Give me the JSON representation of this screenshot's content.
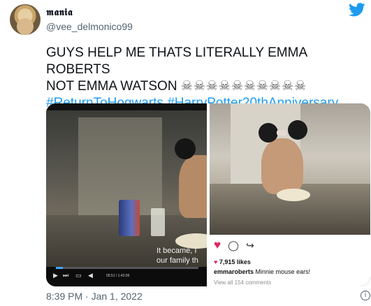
{
  "author": {
    "display_name": "𝖒𝖆𝖓𝖎𝖆",
    "handle": "@vee_delmonico99"
  },
  "tweet": {
    "line1": "GUYS HELP ME THATS LITERALLY EMMA ROBERTS",
    "line2": "NOT EMMA WATSON",
    "skulls": "☠☠☠☠☠☠☠☠☠☠",
    "hashtag1": "#ReturnToHogwarts",
    "hashtag2": "#HarryPotter20thAnniversary"
  },
  "video": {
    "subtitle_line1": "It became, I",
    "subtitle_line2": "our family th",
    "time": "05:51 / 1:42:06",
    "progress": 0.05
  },
  "instagram": {
    "likes": "7,915 likes",
    "caption_user": "emmaroberts",
    "caption_text": "Minnie mouse ears!",
    "view_comments": "View all 154 comments"
  },
  "footer": {
    "timestamp": "8:39 PM · Jan 1, 2022"
  },
  "colors": {
    "accent": "#1d9bf0",
    "heart": "#e0245e"
  }
}
